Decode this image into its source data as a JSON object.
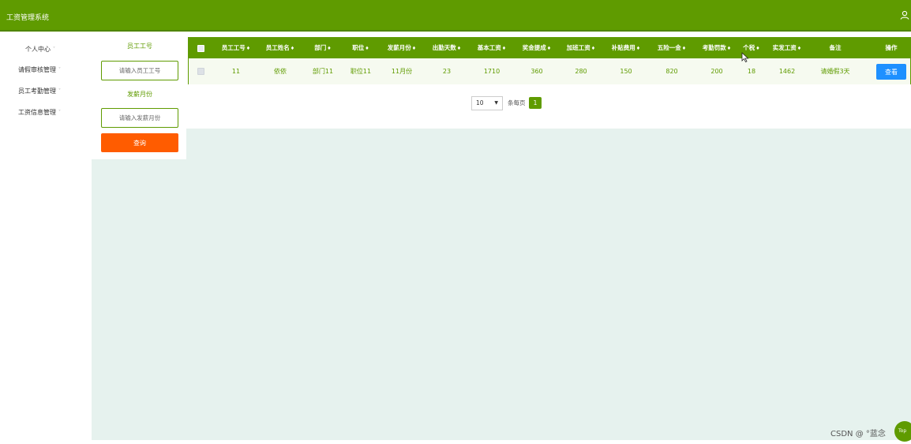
{
  "header": {
    "title": "工资管理系统",
    "user_icon": "user-icon"
  },
  "sidebar": {
    "items": [
      {
        "label": "个人中心",
        "caret": "˅"
      },
      {
        "label": "请假审核管理",
        "caret": "˅"
      },
      {
        "label": "员工考勤管理",
        "caret": "˅"
      },
      {
        "label": "工资信息管理",
        "caret": "˅"
      }
    ]
  },
  "search": {
    "employee_no_label": "员工工号",
    "employee_no_placeholder": "请输入员工工号",
    "pay_month_label": "发薪月份",
    "pay_month_placeholder": "请输入发薪月份",
    "query_label": "查询"
  },
  "table": {
    "headers": [
      "员工工号",
      "员工姓名",
      "部门",
      "职位",
      "发薪月份",
      "出勤天数",
      "基本工资",
      "奖金提成",
      "加班工资",
      "补贴费用",
      "五险一金",
      "考勤罚款",
      "个税",
      "实发工资",
      "备注",
      "操作"
    ],
    "sort_marks": [
      "♦",
      "♦",
      "♦",
      "♦",
      "♦",
      "♦",
      "♦",
      "♦",
      "♦",
      "♦",
      "♦",
      "♦",
      "♦",
      "♦",
      "",
      ""
    ],
    "rows": [
      {
        "cells": [
          "11",
          "依依",
          "部门11",
          "职位11",
          "11月份",
          "23",
          "1710",
          "360",
          "280",
          "150",
          "820",
          "200",
          "18",
          "1462",
          "请婚假3天"
        ],
        "view_label": "查看"
      }
    ]
  },
  "pagination": {
    "page_size": "10",
    "per_page_text": "条每页",
    "current_page": "1"
  },
  "watermark": "CSDN @ °蓝念",
  "top_button": "Top",
  "colors": {
    "brand_green": "#5f9b00",
    "query_orange": "#ff5c00",
    "view_blue": "#1e90ff",
    "content_bg": "#e6f2ee"
  }
}
